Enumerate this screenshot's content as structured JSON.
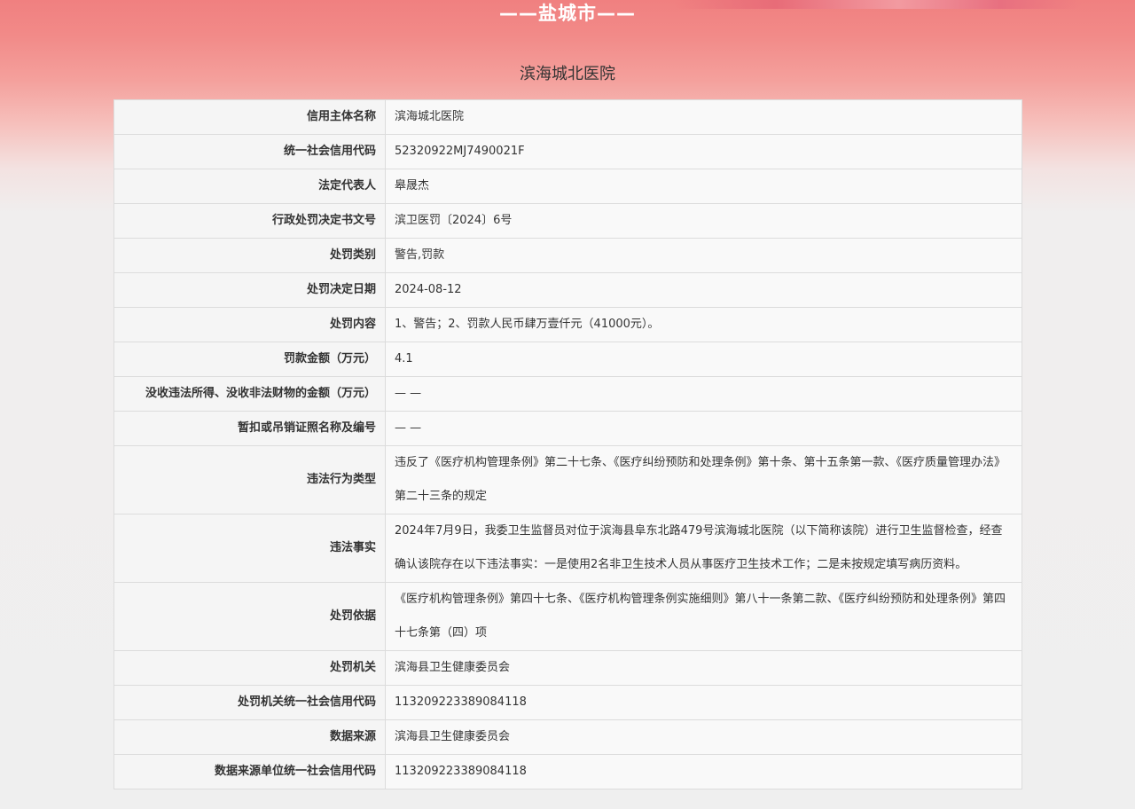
{
  "header": {
    "city": "——盐城市——",
    "org_name": "滨海城北医院"
  },
  "rows": [
    {
      "label": "信用主体名称",
      "value": "滨海城北医院"
    },
    {
      "label": "统一社会信用代码",
      "value": "52320922MJ7490021F"
    },
    {
      "label": "法定代表人",
      "value": "皋晟杰"
    },
    {
      "label": "行政处罚决定书文号",
      "value": "滨卫医罚〔2024〕6号"
    },
    {
      "label": "处罚类别",
      "value": "警告,罚款"
    },
    {
      "label": "处罚决定日期",
      "value": "2024-08-12"
    },
    {
      "label": "处罚内容",
      "value": "1、警告；2、罚款人民币肆万壹仟元（41000元）。"
    },
    {
      "label": "罚款金额（万元）",
      "value": "4.1"
    },
    {
      "label": "没收违法所得、没收非法财物的金额（万元）",
      "value": "— —"
    },
    {
      "label": "暂扣或吊销证照名称及编号",
      "value": "— —"
    },
    {
      "label": "违法行为类型",
      "value": "违反了《医疗机构管理条例》第二十七条、《医疗纠纷预防和处理条例》第十条、第十五条第一款、《医疗质量管理办法》第二十三条的规定"
    },
    {
      "label": "违法事实",
      "value": "2024年7月9日，我委卫生监督员对位于滨海县阜东北路479号滨海城北医院（以下简称该院）进行卫生监督检查，经查确认该院存在以下违法事实：一是使用2名非卫生技术人员从事医疗卫生技术工作；二是未按规定填写病历资料。"
    },
    {
      "label": "处罚依据",
      "value": "《医疗机构管理条例》第四十七条、《医疗机构管理条例实施细则》第八十一条第二款、《医疗纠纷预防和处理条例》第四十七条第（四）项"
    },
    {
      "label": "处罚机关",
      "value": "滨海县卫生健康委员会"
    },
    {
      "label": "处罚机关统一社会信用代码",
      "value": "11320922338908411​8"
    },
    {
      "label": "数据来源",
      "value": "滨海县卫生健康委员会"
    },
    {
      "label": "数据来源单位统一社会信用代码",
      "value": "113209223389084118"
    }
  ]
}
